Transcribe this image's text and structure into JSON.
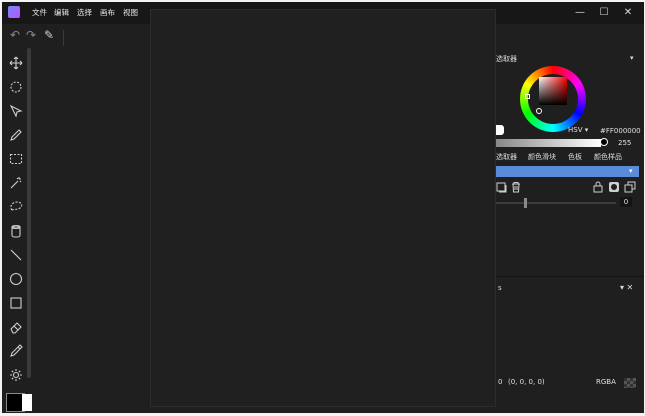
{
  "window": {
    "menu": [
      "文件",
      "编辑",
      "选择",
      "画布",
      "视图"
    ],
    "controls": {
      "minimize": "—",
      "maximize": "☐",
      "close": "✕"
    }
  },
  "toolbar": {
    "undo_icon": "↶",
    "redo_icon": "↷",
    "edit_icon": "✎"
  },
  "tools": [
    "move-icon",
    "lasso-rotate-icon",
    "select-arrow-icon",
    "pencil-icon",
    "rect-select-icon",
    "magic-wand-icon",
    "free-lasso-icon",
    "bucket-icon",
    "line-icon",
    "ellipse-icon",
    "rectangle-icon",
    "eraser-icon",
    "eyedropper-icon",
    "brightness-icon"
  ],
  "color_panel": {
    "title": "选取器",
    "dropdown": "▾",
    "mode": "HSV ▾",
    "hex": "#FF000000",
    "alpha_value": "255",
    "tabs": [
      "选取器",
      "颜色滑块",
      "色板",
      "颜色样品"
    ]
  },
  "layer_panel": {
    "dropdown": "▾",
    "opacity_value": "0"
  },
  "bottom_panel": {
    "title": "s",
    "controls": "▾ ✕",
    "status_x": "0",
    "status_rgba_values": "(0, 0, 0, 0)",
    "format": "RGBA"
  }
}
